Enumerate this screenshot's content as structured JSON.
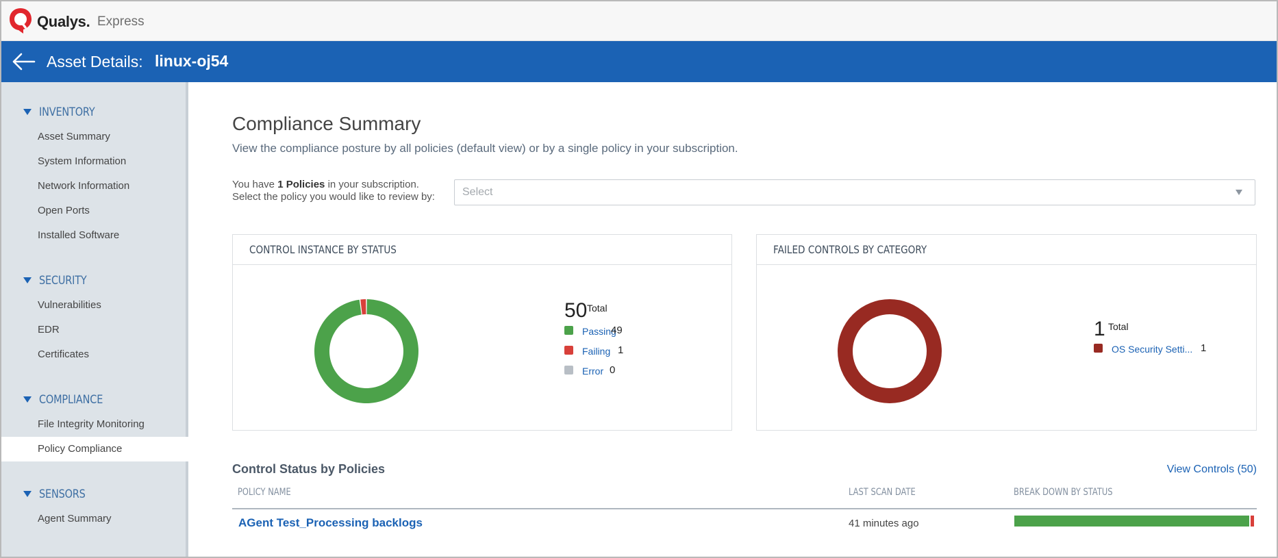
{
  "brand": {
    "name": "Qualys.",
    "product": "Express"
  },
  "header": {
    "title_label": "Asset Details:",
    "asset_name": "linux-oj54"
  },
  "sidebar": {
    "sections": [
      {
        "label": "INVENTORY",
        "items": [
          "Asset Summary",
          "System Information",
          "Network Information",
          "Open Ports",
          "Installed Software"
        ]
      },
      {
        "label": "SECURITY",
        "items": [
          "Vulnerabilities",
          "EDR",
          "Certificates"
        ]
      },
      {
        "label": "COMPLIANCE",
        "items": [
          "File Integrity Monitoring",
          "Policy Compliance"
        ]
      },
      {
        "label": "SENSORS",
        "items": [
          "Agent Summary"
        ]
      }
    ],
    "active_item": "Policy Compliance"
  },
  "main": {
    "title": "Compliance Summary",
    "subtitle": "View the compliance posture by all policies (default view) or by a single policy in your subscription.",
    "policy_note": {
      "prefix": "You have ",
      "count_text": "1 Policies",
      "suffix": " in your subscription.",
      "line2": "Select the policy you would like to review by:"
    },
    "select": {
      "placeholder": "Select"
    }
  },
  "chart_data": [
    {
      "type": "pie",
      "title": "CONTROL INSTANCE BY STATUS",
      "total": 50,
      "total_label": "Total",
      "categories": [
        "Passing",
        "Failing",
        "Error"
      ],
      "values": [
        49,
        1,
        0
      ],
      "colors": [
        "#4ca24a",
        "#d8403a",
        "#b8bec5"
      ],
      "legend": "right"
    },
    {
      "type": "pie",
      "title": "FAILED CONTROLS BY CATEGORY",
      "total": 1,
      "total_label": "Total",
      "categories": [
        "OS Security Setti..."
      ],
      "values": [
        1
      ],
      "colors": [
        "#982a22"
      ],
      "legend": "right"
    }
  ],
  "controls": {
    "title": "Control Status by Policies",
    "view_link": "View Controls (50)",
    "columns": [
      "POLICY NAME",
      "LAST SCAN DATE",
      "BREAK DOWN BY STATUS"
    ],
    "rows": [
      {
        "policy_name": "AGent Test_Processing backlogs",
        "last_scan": "41 minutes ago",
        "breakdown": {
          "passing": 49,
          "failing": 1,
          "error": 0
        }
      }
    ]
  },
  "colors": {
    "accent": "#1b62b4",
    "passing": "#4ca24a",
    "failing": "#d8403a",
    "error": "#b8bec5",
    "category": "#982a22"
  }
}
